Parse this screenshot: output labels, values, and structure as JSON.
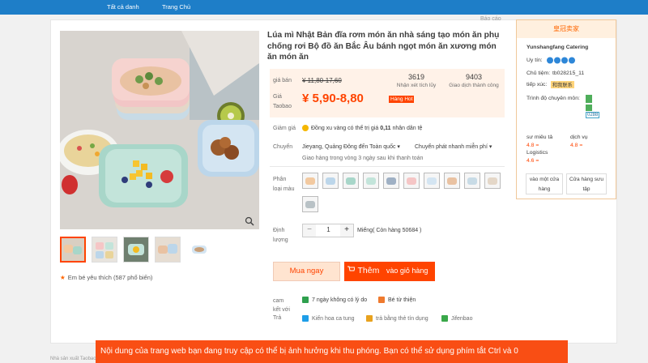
{
  "topnav": {
    "links": [
      "Tất cả danh",
      "Trang Chủ"
    ]
  },
  "report": "Báo cáo",
  "product": {
    "title": "Lúa mì Nhật Bản đĩa rơm món ăn nhà sáng tạo món ăn phụ chống rơi Bộ đồ ăn Bắc Âu bánh ngọt món ăn xương món ăn món ăn",
    "favorites": "Em bé yêu thích (587 phổ biến)"
  },
  "price": {
    "original_label": "giá bán",
    "original": "¥ 11,80-17,60",
    "taobao_label": "Giá Taobao",
    "current": "¥ 5,90-8,80",
    "hot_badge": "Hàng Hot",
    "reviews_count": "3619",
    "reviews_label": "Nhận xét tích lũy",
    "trades_count": "9403",
    "trades_label": "Giao dịch thành công"
  },
  "discount": {
    "label": "Giảm giá",
    "text": "Đồng xu vàng có thể trị giá",
    "amount": "0,11",
    "suffix": "nhân dân tệ"
  },
  "shipping": {
    "label": "Chuyển",
    "from_to": "Jieyang, Quảng Đông đến Toàn quốc",
    "option": "Chuyển phát nhanh miễn phí",
    "note": "Giao hàng trong vòng 3 ngày sau khi thanh toán"
  },
  "variants": {
    "label": "Phân loại màu"
  },
  "quantity": {
    "label": "Định lượng",
    "value": "1",
    "minus": "−",
    "plus": "+",
    "stock": "Miếng( Còn hàng 50684 )"
  },
  "actions": {
    "buy_now": "Mua ngay",
    "add_cart_1": "Thêm",
    "add_cart_2": "vào giỏ hàng"
  },
  "promise": {
    "label": "cam kết với",
    "item1": "7 ngày không có lý do",
    "item2": "Bé từ thiện"
  },
  "payment": {
    "label": "Trả",
    "item1": "Kiến hoa ca tung",
    "item2": "trả bằng thẻ tín dụng",
    "item3": "Jifenbao"
  },
  "seller": {
    "badge": "皇冠卖家",
    "name": "Yunshangfang Catering",
    "trust_label": "Uy tín:",
    "owner_label": "Chủ tiệm:",
    "owner": "tb028215_11",
    "contact_label": "tiếp xúc:",
    "contact_chip": "和我联系",
    "qual_label": "Trình độ chuyên môn:",
    "qual_code": "0288",
    "desc_label": "sư miêu tả",
    "desc_score": "4.8 =",
    "service_label": "dịch vụ",
    "service_score": "4.8 =",
    "logistics_label": "Logistics",
    "logistics_score": "4.6 =",
    "btn_visit": "vào một cửa hàng",
    "btn_collect": "Cửa hàng sưu tập"
  },
  "toast": "Nội dung của trang web bạn đang truy cập có thể bị ảnh hưởng khi thu phóng. Bạn có thể sử dụng phím tắt Ctrl và 0",
  "bottom_fragment": "Nhà sản xuất Taobao"
}
